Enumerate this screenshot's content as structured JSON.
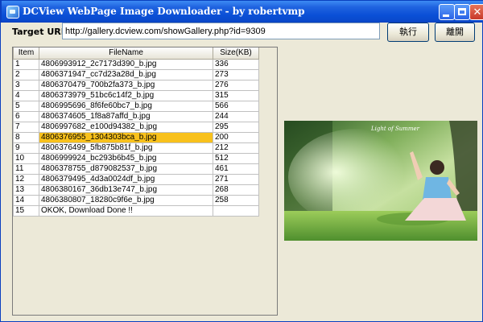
{
  "window": {
    "title": "DCView WebPage Image Downloader - by robertvmp"
  },
  "form": {
    "url_label": "Target URL :",
    "url_value": "http://gallery.dcview.com/showGallery.php?id=9309",
    "run_label": "執行",
    "leave_label": "離開"
  },
  "table": {
    "headers": [
      "Item",
      "FileName",
      "Size(KB)"
    ],
    "rows": [
      {
        "item": "1",
        "file": "4806993912_2c7173d390_b.jpg",
        "size": "336"
      },
      {
        "item": "2",
        "file": "4806371947_cc7d23a28d_b.jpg",
        "size": "273"
      },
      {
        "item": "3",
        "file": "4806370479_700b2fa373_b.jpg",
        "size": "276"
      },
      {
        "item": "4",
        "file": "4806373979_51bc6c14f2_b.jpg",
        "size": "315"
      },
      {
        "item": "5",
        "file": "4806995696_8f6fe60bc7_b.jpg",
        "size": "566"
      },
      {
        "item": "6",
        "file": "4806374605_1f8a87affd_b.jpg",
        "size": "244"
      },
      {
        "item": "7",
        "file": "4806997682_e100d94382_b.jpg",
        "size": "295"
      },
      {
        "item": "8",
        "file": "4806376955_1304303bca_b.jpg",
        "size": "200"
      },
      {
        "item": "9",
        "file": "4806376499_5fb875b81f_b.jpg",
        "size": "212"
      },
      {
        "item": "10",
        "file": "4806999924_bc293b6b45_b.jpg",
        "size": "512"
      },
      {
        "item": "11",
        "file": "4806378755_d879082537_b.jpg",
        "size": "461"
      },
      {
        "item": "12",
        "file": "4806379495_4d3a0024df_b.jpg",
        "size": "271"
      },
      {
        "item": "13",
        "file": "4806380167_36db13e747_b.jpg",
        "size": "268"
      },
      {
        "item": "14",
        "file": "4806380807_18280c9f6e_b.jpg",
        "size": "258"
      },
      {
        "item": "15",
        "file": "OKOK, Download Done !!",
        "size": ""
      }
    ]
  },
  "preview": {
    "caption": "Light of Summer"
  },
  "colors": {
    "title_bar": "#0a4fd6",
    "selection": "#f8c11c",
    "window_bg": "#ece9d8"
  }
}
